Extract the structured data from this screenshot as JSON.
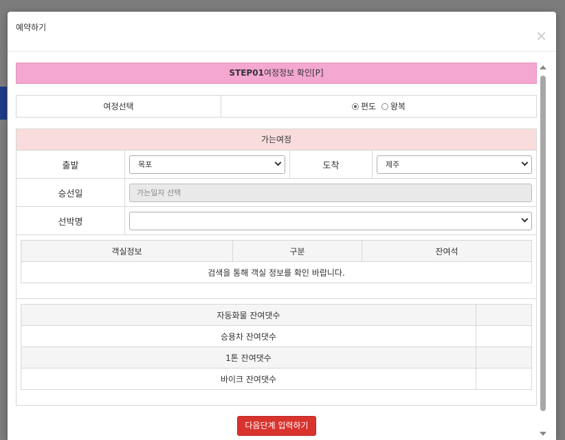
{
  "modal": {
    "title": "예약하기",
    "close_glyph": "×"
  },
  "step": {
    "number": "STEP01",
    "title": "여정정보 확인[P]"
  },
  "trip_select": {
    "label": "여정선택",
    "options": [
      {
        "label": "편도",
        "checked": true
      },
      {
        "label": "왕복",
        "checked": false
      }
    ]
  },
  "outbound": {
    "header": "가는여정",
    "departure_label": "출발",
    "departure_value": "목포",
    "arrival_label": "도착",
    "arrival_value": "제주",
    "date_label": "승선일",
    "date_placeholder": "가는일자 선택",
    "ship_label": "선박명",
    "ship_value": ""
  },
  "rooms": {
    "columns": [
      "객실정보",
      "구분",
      "잔여석"
    ],
    "empty_message": "검색을 통해 객실 정보를 확인 바랍니다."
  },
  "cars": {
    "rows": [
      {
        "label": "자동화물 잔여댓수",
        "count": ""
      },
      {
        "label": "승용차 잔여댓수",
        "count": ""
      },
      {
        "label": "1톤 잔여댓수",
        "count": ""
      },
      {
        "label": "바이크 잔여댓수",
        "count": ""
      }
    ]
  },
  "footer": {
    "next_button": "다음단계 입력하기"
  },
  "colors": {
    "step_bg": "#f4a7d0",
    "outbound_head_bg": "#f9dcdc",
    "button_bg": "#d9332e"
  }
}
